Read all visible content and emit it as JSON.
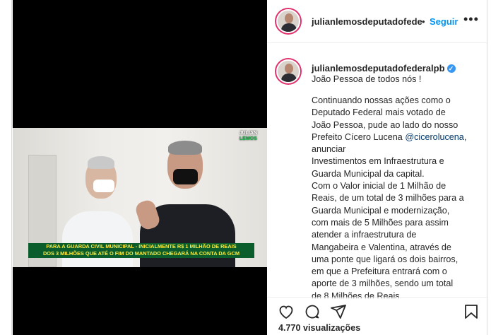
{
  "post": {
    "username_header": "julianlemosdeputadofede",
    "dot": "•",
    "follow_label": "Seguir",
    "more_label": "•••",
    "username_caption": "julianlemosdeputadofederalpb",
    "verified_mark": "✓",
    "caption_title": "João Pessoa de todos nós !",
    "caption_lines": [
      "Continuando nossas ações como o",
      "Deputado Federal mais votado de",
      "João Pessoa, pude ao lado do nosso",
      "Prefeito Cícero Lucena ",
      "@cicerolucena",
      ",",
      "anunciar",
      "Investimentos em Infraestrutura e",
      "Guarda Municipal da capital.",
      "Com o Valor inicial de 1 Milhão de",
      "Reais, de um total de 3 milhões para a",
      "Guarda Municipal e modernização,",
      "com mais de 5 Milhões para assim",
      "atender a infraestrutura de",
      "Mangabeira e Valentina, através de",
      "uma ponte que ligará os dois bairros,",
      "em que a Prefeitura entrará com o",
      "aporte de 3 milhões, sendo um total",
      "de 8 Milhões de Reais"
    ],
    "views_label": "4.770 visualizações"
  },
  "video": {
    "banner_line1": "PARA A GUARDA CIVIL MUNICIPAL - INICIALMENTE R$ 1 MILHÃO DE REAIS",
    "banner_line2": "DOS 3 MILHÕES QUE ATÉ O FIM DO MANTADO CHEGARÁ NA CONTA DA GCM",
    "watermark_line1": "JULIAN",
    "watermark_line2": "LEMOS"
  },
  "colors": {
    "follow": "#0095f6",
    "verified": "#3897f0",
    "mention": "#00376b",
    "banner_bg": "#0b5d2c",
    "banner_text": "#ffeb3b"
  },
  "icons": [
    "heart-icon",
    "comment-icon",
    "share-icon",
    "bookmark-icon",
    "verified-icon",
    "more-icon"
  ]
}
